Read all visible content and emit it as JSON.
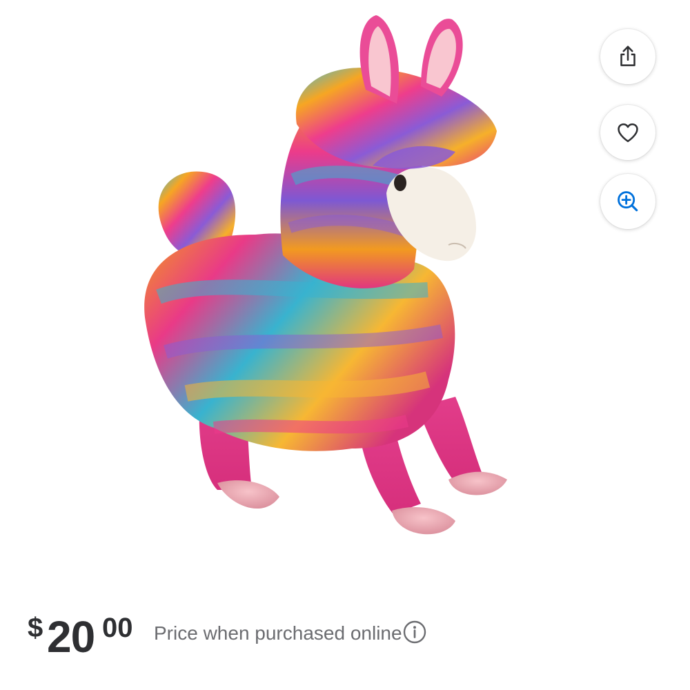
{
  "product": {
    "image_alt": "Rainbow fluffy llama plush toy"
  },
  "actions": {
    "share_icon": "share-icon",
    "favorite_icon": "heart-icon",
    "zoom_icon": "zoom-in-icon",
    "zoom_accent": "#0071dc"
  },
  "price": {
    "currency": "$",
    "dollars": "20",
    "cents": "00",
    "note": "Price when purchased online",
    "info_icon": "info-icon"
  },
  "colors": {
    "text_primary": "#2e2f32",
    "text_secondary": "#6b6c70",
    "accent_blue": "#0071dc"
  }
}
